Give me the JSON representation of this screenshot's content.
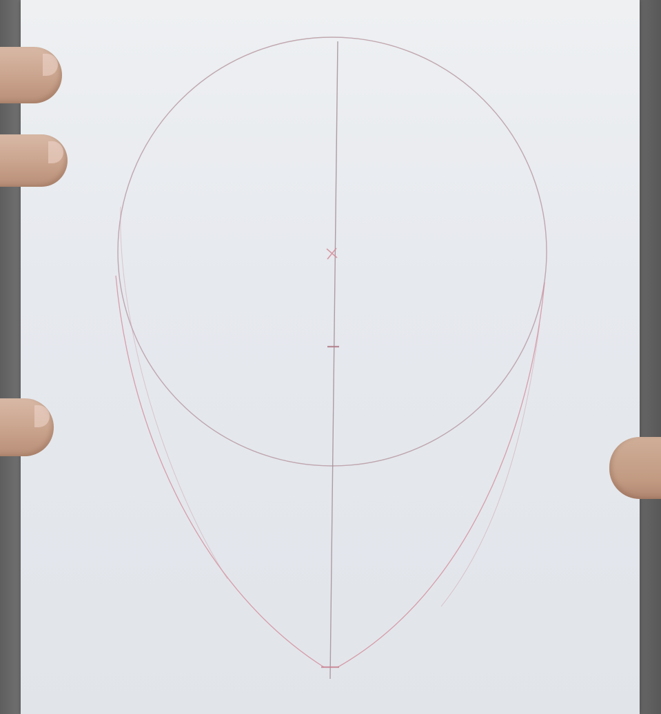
{
  "scene": {
    "description_name": "face-proportion-sketch",
    "paper_color": "#e6e9ee",
    "pencil_color": "#c9a3aa",
    "red_pencil_color": "#d98a96"
  },
  "marks": {
    "center_mark_symbol": "x",
    "lower_mark_symbol": "-"
  }
}
